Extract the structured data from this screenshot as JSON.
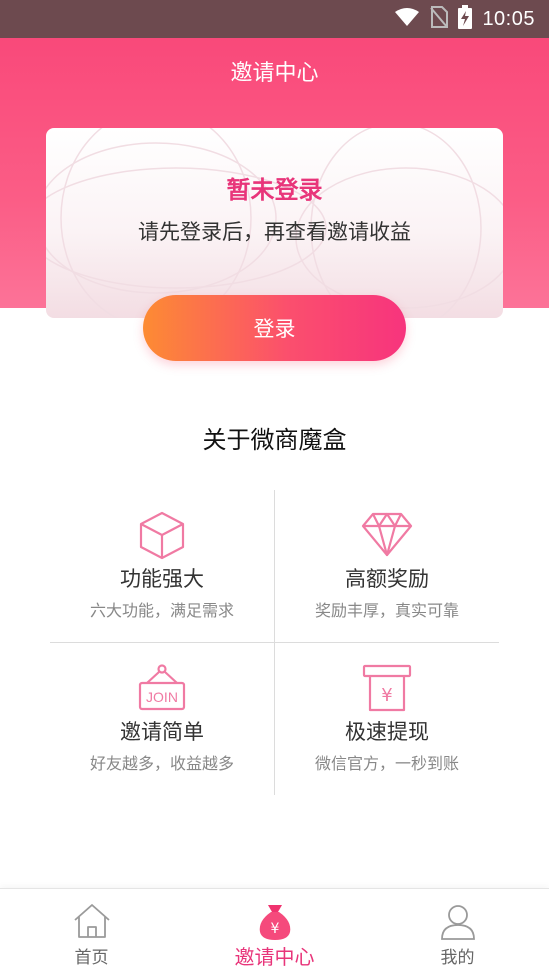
{
  "status_bar": {
    "time": "10:05"
  },
  "header": {
    "title": "邀请中心"
  },
  "login_card": {
    "title": "暂未登录",
    "subtitle": "请先登录后，再查看邀请收益"
  },
  "login_button": {
    "label": "登录"
  },
  "about": {
    "title": "关于微商魔盒",
    "features": [
      {
        "icon": "cube-icon",
        "name": "功能强大",
        "desc": "六大功能，满足需求"
      },
      {
        "icon": "diamond-icon",
        "name": "高额奖励",
        "desc": "奖励丰厚，真实可靠"
      },
      {
        "icon": "join-sign-icon",
        "name": "邀请简单",
        "desc": "好友越多，收益越多"
      },
      {
        "icon": "yen-withdraw-icon",
        "name": "极速提现",
        "desc": "微信官方，一秒到账"
      }
    ]
  },
  "tabs": [
    {
      "icon": "home-icon",
      "label": "首页",
      "active": false
    },
    {
      "icon": "money-bag-icon",
      "label": "邀请中心",
      "active": true
    },
    {
      "icon": "user-icon",
      "label": "我的",
      "active": false
    }
  ],
  "colors": {
    "accent": "#e8357a",
    "header_top": "#f9497a",
    "button_start": "#fd8b33",
    "button_end": "#f7347d",
    "status_bar": "#6d4a4f"
  }
}
